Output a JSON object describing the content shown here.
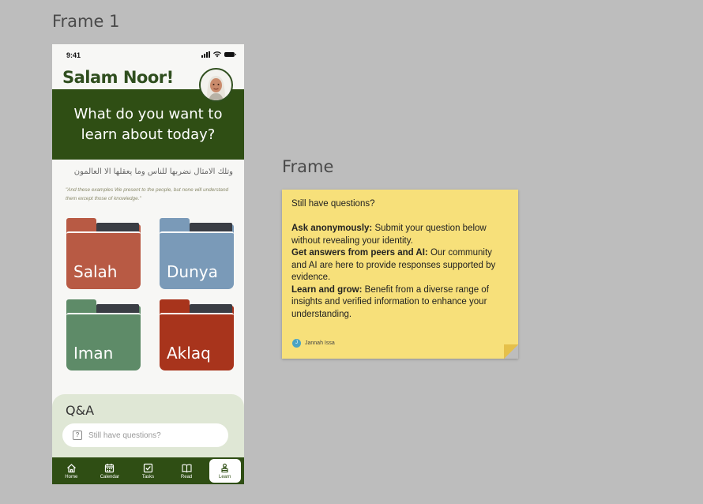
{
  "canvas": {
    "frame1_label": "Frame 1",
    "frame2_label": "Frame"
  },
  "phone": {
    "status_time": "9:41",
    "greeting": "Salam Noor!",
    "hero_text": "What do you want to learn about today?",
    "arabic_verse": "وتلك الامثال نضربها للناس وما يعقلها الا العالمون",
    "quote": "\"And these examples We present to the people, but none will understand them except those of knowledge.\"",
    "folders": [
      {
        "name": "Salah",
        "color": "#b85a44"
      },
      {
        "name": "Dunya",
        "color": "#7a9ab8"
      },
      {
        "name": "Iman",
        "color": "#5e8b68"
      },
      {
        "name": "Aklaq",
        "color": "#a8341c"
      }
    ],
    "qa": {
      "title": "Q&A",
      "placeholder": "Still have questions?"
    },
    "nav": {
      "home": "Home",
      "calendar": "Calendar",
      "tasks": "Tasks",
      "read": "Read",
      "learn": "Learn",
      "active": "Learn"
    }
  },
  "sticky": {
    "line1": "Still have questions?",
    "b1_bold": "Ask anonymously:",
    "b1_text": " Submit your question below without revealing your identity.",
    "b2_bold": "Get answers from peers and AI:",
    "b2_text": " Our community and AI are here to provide responses supported by evidence.",
    "b3_bold": "Learn and grow:",
    "b3_text": " Benefit from a diverse range of insights and verified information to enhance your understanding.",
    "author_initial": "J",
    "author": "Jannah Issa",
    "color": "#f7e07a"
  }
}
